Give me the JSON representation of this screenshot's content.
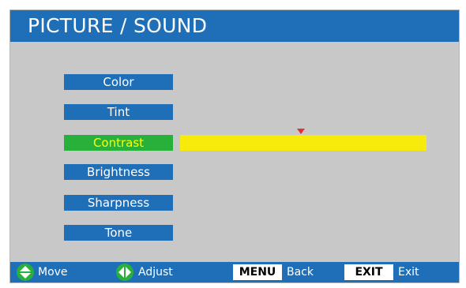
{
  "header": {
    "title": "PICTURE / SOUND"
  },
  "menu": {
    "items": [
      {
        "label": "Color",
        "selected": false
      },
      {
        "label": "Tint",
        "selected": false
      },
      {
        "label": "Contrast",
        "selected": true
      },
      {
        "label": "Brightness",
        "selected": false
      },
      {
        "label": "Sharpness",
        "selected": false
      },
      {
        "label": "Tone",
        "selected": false
      }
    ]
  },
  "slider": {
    "setting": "Contrast",
    "level_fraction": 0.49,
    "track_color": "#f7eb0b",
    "marker_color": "#e53030"
  },
  "footer": {
    "move_icon": "up-down-arrows-icon",
    "move_label": "Move",
    "adjust_icon": "left-right-arrows-icon",
    "adjust_label": "Adjust",
    "menu_key": "MENU",
    "menu_label": "Back",
    "exit_key": "EXIT",
    "exit_label": "Exit"
  },
  "colors": {
    "accent_blue": "#1f6fb8",
    "selected_green": "#27b13a",
    "selected_text": "#ffff00",
    "background_gray": "#c9c8c8"
  }
}
